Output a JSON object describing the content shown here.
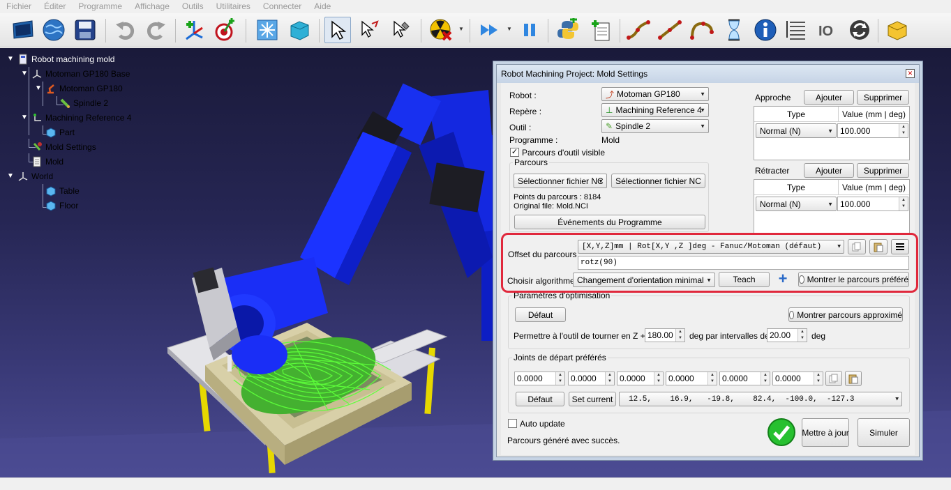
{
  "menu": [
    "Fichier",
    "Éditer",
    "Programme",
    "Affichage",
    "Outils",
    "Utilitaires",
    "Connecter",
    "Aide"
  ],
  "tree": [
    {
      "label": "Robot machining mold",
      "icon": "station-icon"
    },
    {
      "label": "Motoman GP180 Base",
      "icon": "frame-icon"
    },
    {
      "label": "Motoman GP180",
      "icon": "robot-icon"
    },
    {
      "label": "Spindle 2",
      "icon": "tool-icon"
    },
    {
      "label": "Machining Reference 4",
      "icon": "frame-icon"
    },
    {
      "label": "Part",
      "icon": "object-icon"
    },
    {
      "label": "Mold Settings",
      "icon": "machining-icon"
    },
    {
      "label": "Mold",
      "icon": "program-icon"
    },
    {
      "label": "World",
      "icon": "frame-icon"
    },
    {
      "label": "Table",
      "icon": "object-icon"
    },
    {
      "label": "Floor",
      "icon": "object-icon"
    }
  ],
  "dialog": {
    "title": "Robot Machining Project: Mold Settings",
    "robot_label": "Robot :",
    "robot_value": "Motoman GP180",
    "repere_label": "Repère :",
    "repere_value": "Machining Reference 4",
    "outil_label": "Outil :",
    "outil_value": "Spindle 2",
    "programme_label": "Programme :",
    "programme_value": "Mold",
    "parcours_visible": "Parcours d'outil visible",
    "parcours_group": "Parcours",
    "select_nc_combo": "Sélectionner fichier NC",
    "select_nc_button": "Sélectionner fichier NC",
    "points_text": "Points du parcours : 8184",
    "original_file": "Original file: Mold.NCI",
    "events_button": "Événements du Programme",
    "approche": {
      "label": "Approche",
      "add": "Ajouter",
      "remove": "Supprimer",
      "col_type": "Type",
      "col_value": "Value (mm | deg)",
      "type_value": "Normal (N)",
      "value": "100.000"
    },
    "retracter": {
      "label": "Rétracter",
      "add": "Ajouter",
      "remove": "Supprimer",
      "col_type": "Type",
      "col_value": "Value (mm | deg)",
      "type_value": "Normal (N)",
      "value": "100.000"
    },
    "offset_label": "Offset du parcours :",
    "offset_combo": "[X,Y,Z]mm | Rot[X,Y ,Z  ]deg - Fanuc/Motoman (défaut)",
    "offset_value": "rotz(90)",
    "algo_label": "Choisir algorithme :",
    "algo_value": "Changement d'orientation minimal",
    "teach_button": "Teach",
    "show_preferred": "Montrer le parcours préféré",
    "optim_group": "Paramètres d'optimisation",
    "default_button": "Défaut",
    "show_approx": "Montrer parcours approximé",
    "rotate_label": "Permettre à l'outil de tourner en Z +/-",
    "rotate_value": "180.00",
    "deg_interval": "deg par intervalles de",
    "interval_value": "20.00",
    "deg": "deg",
    "joints_group": "Joints de départ préférés",
    "joints": [
      "0.0000",
      "0.0000",
      "0.0000",
      "0.0000",
      "0.0000",
      "0.0000"
    ],
    "joints_default": "Défaut",
    "set_current": "Set current",
    "joints_combo": "12.5,    16.9,   -19.8,    82.4,  -100.0,  -127.3",
    "auto_update": "Auto update",
    "status": "Parcours généré avec succès.",
    "update_button": "Mettre à jour",
    "simulate_button": "Simuler"
  }
}
